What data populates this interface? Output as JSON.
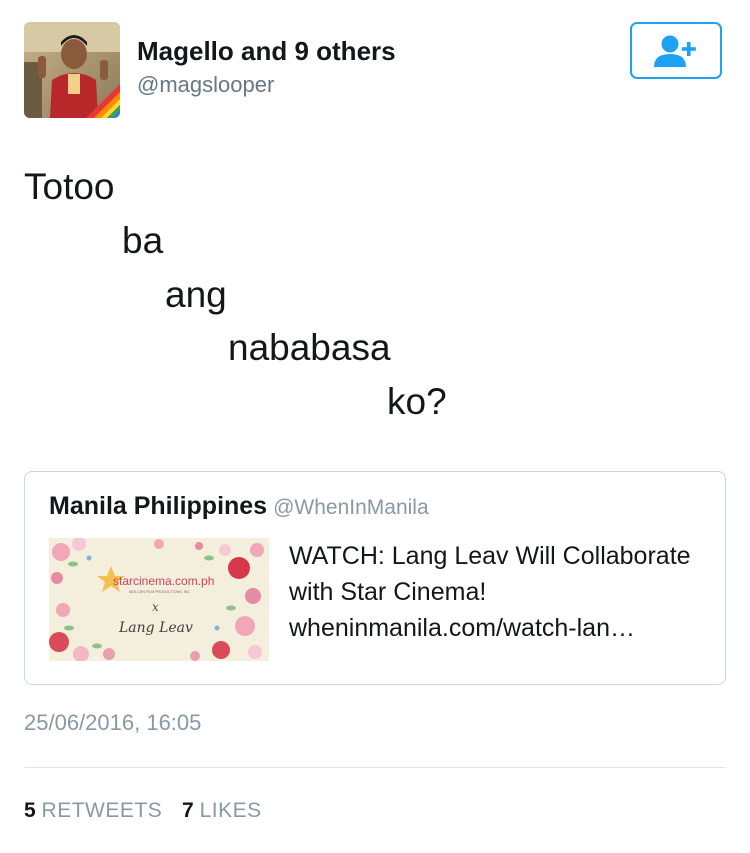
{
  "author": {
    "display_name": "Magello and 9 others",
    "handle": "@magslooper",
    "avatar_icon": "user-photo-avatar"
  },
  "follow_button": {
    "icon": "add-user-icon",
    "color": "#1da1f2"
  },
  "tweet": {
    "lines": [
      "Totoo",
      "ba",
      "ang",
      "nababasa",
      "ko?"
    ]
  },
  "quoted_card": {
    "author_name": "Manila Philippines",
    "author_handle": "@WhenInManila",
    "thumbnail": {
      "site_text": "starcinema.com.ph",
      "tagline": "ABS-CBN FILM PRODUCTIONS, INC.",
      "x_mark": "x",
      "signature": "Lang Leav"
    },
    "title": "WATCH: Lang Leav Will Collaborate with Star Cinema!",
    "url": "wheninmanila.com/watch-lan…"
  },
  "timestamp": "25/06/2016, 16:05",
  "stats": {
    "retweets_count": "5",
    "retweets_label": "RETWEETS",
    "likes_count": "7",
    "likes_label": "LIKES"
  },
  "colors": {
    "text": "#14171a",
    "secondary": "#657786",
    "muted": "#8899a6",
    "accent": "#1da1f2",
    "border": "#ccd6dd"
  }
}
